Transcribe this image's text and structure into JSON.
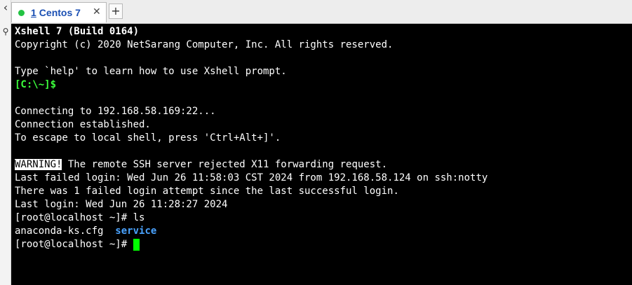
{
  "tabs": [
    {
      "number": "1",
      "label": "Centos 7"
    }
  ],
  "icons": {
    "status_dot": "green-connected-dot",
    "tab_close": "close-icon",
    "tab_add": "plus-icon",
    "left_arrow": "chevron-left-icon",
    "left_search": "search-icon"
  },
  "glyphs": {
    "close": "✕",
    "add": "+",
    "left": "‹",
    "search": "⚲"
  },
  "colors": {
    "terminal_bg": "#000000",
    "prompt_green": "#3cff3c",
    "directory_blue": "#4aa3ff",
    "cursor": "#00ff00",
    "status_dot": "#23c343"
  },
  "terminal": {
    "banner_title": "Xshell 7 (Build 0164)",
    "copyright": "Copyright (c) 2020 NetSarang Computer, Inc. All rights reserved.",
    "help_hint": "Type `help' to learn how to use Xshell prompt.",
    "local_prompt": "[C:\\~]$",
    "connecting": "Connecting to 192.168.58.169:22...",
    "established": "Connection established.",
    "escape_hint": "To escape to local shell, press 'Ctrl+Alt+]'.",
    "warning_tag": "WARNING!",
    "warning_text": " The remote SSH server rejected X11 forwarding request.",
    "last_failed": "Last failed login: Wed Jun 26 11:58:03 CST 2024 from 192.168.58.124 on ssh:notty",
    "failed_attempts": "There was 1 failed login attempt since the last successful login.",
    "last_login": "Last login: Wed Jun 26 11:28:27 2024",
    "prompt1": "[root@localhost ~]# ",
    "command1": "ls",
    "ls_file": "anaconda-ks.cfg",
    "ls_gap": "  ",
    "ls_dir": "service",
    "prompt2": "[root@localhost ~]# "
  }
}
